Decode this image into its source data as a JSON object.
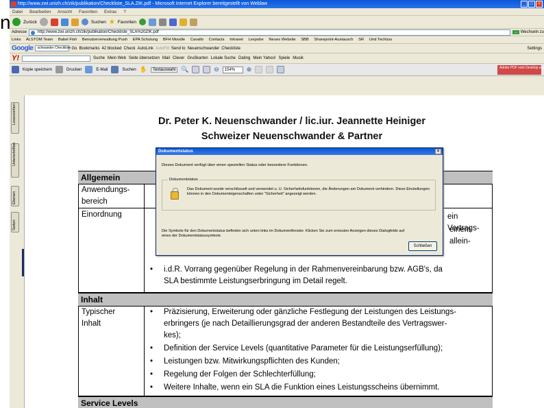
{
  "edge_char": "n",
  "browser": {
    "title": "http://www.zwi.unizh.ch/zik/publikation/Checkliste_SLA.ZIK.pdf - Microsoft Internet Explorer bereitgestellt von Weblaw",
    "menu": [
      "Datei",
      "Bearbeiten",
      "Ansicht",
      "Favoriten",
      "Extras",
      "?"
    ],
    "nav": {
      "back": "Zurück",
      "search": "Suchen",
      "favorites": "Favoriten"
    },
    "address": {
      "label": "Adresse",
      "url": "http://www.zwi.unizh.ch/zik/publikation/Checkliste_SLA%20ZIK.pdf",
      "go": "Wechseln zu"
    },
    "links": [
      "Links",
      "ALSTOM Team",
      "Babel Fish",
      "Benutzerverwaltung Push",
      "EPA Schulung",
      "BFH Moodle",
      "Cavallo",
      "Contacts",
      "Intranet",
      "Lexpobe",
      "Neues Website",
      "SBB",
      "Sharepoint-Austausch",
      "SR",
      "Und Techüss"
    ],
    "google": {
      "logo": "Google",
      "query": "schwander Checkliste",
      "go": "Go",
      "bookmarks": "Bookmarks",
      "blocked": "42 blocked",
      "check": "Check",
      "autolink": "AutoLink",
      "autofill": "AutoFill",
      "sendto": "Send to",
      "term1": "Neuenschwander",
      "term2": "Checkliste",
      "settings": "Settings"
    },
    "yahoo": {
      "logo": "Y!",
      "search": "Suche",
      "mail": "Mein Web",
      "translate": "Seite übersetzen",
      "email": "Mail",
      "clever": "Clever",
      "maps": "Grußkarten",
      "local": "Lokale Suche",
      "dating": "Dating",
      "myyahoo": "Mein Yahoo!",
      "games": "Spiele",
      "music": "Musik"
    }
  },
  "pdf_toolbar": {
    "save": "Kopie speichern",
    "print": "Drucken",
    "email": "E-Mail",
    "search": "Suchen",
    "select": "Textauswahl",
    "zoom": "154%",
    "adobe": "Adobe PDF vom Desktop aus erstellen"
  },
  "side_tabs": [
    "Lesezeichen",
    "Unterschriften",
    "Ebenen",
    "Seiten"
  ],
  "document": {
    "title_line1": "Dr. Peter K. Neuenschwander / lic.iur. Jeannette Heiniger",
    "title_line2": "Schweizer Neuenschwander & Partner",
    "sec_allgemein": "Allgemein",
    "lbl_anwendung1": "Anwendungs-",
    "lbl_anwendung2": "bereich",
    "lbl_einordnung": "Einordnung",
    "frag1": "ein Vertrags-",
    "frag2": "einem allein-",
    "bullet_vorrang_1": "i.d.R. Vorrang gegenüber Regelung in der Rahmenvereinbarung bzw. AGB's, da",
    "bullet_vorrang_2": "SLA bestimmte Leistungserbringung im Detail regelt.",
    "sec_inhalt": "Inhalt",
    "lbl_typ1": "Typischer",
    "lbl_typ2": "Inhalt",
    "inhalt_b1_l1": "Präzisierung, Erweiterung oder gänzliche Festlegung der Leistungen des Leistungs-",
    "inhalt_b1_l2": "erbringers (je nach Detaillierungsgrad der anderen Bestandteile des Vertragswer-",
    "inhalt_b1_l3": "kes);",
    "inhalt_b2": "Definition der Service Levels (quantitative Parameter für die Leistungserfüllung);",
    "inhalt_b3": "Leistungen bzw. Mitwirkungspflichten des Kunden;",
    "inhalt_b4": "Regelung der Folgen der Schlechterfüllung;",
    "inhalt_b5": "Weitere Inhalte, wenn ein SLA die Funktion eines Leistungsscheins übernimmt.",
    "sec_service": "Service Levels"
  },
  "dialog": {
    "title": "Dokumentstatus",
    "intro": "Dieses Dokument verfügt über einen speziellen Status oder besondere Funktionen.",
    "group_label": "Dokumentstatus",
    "group_text": "Das Dokument wurde verschlüsselt und verwendet  u. U. Sicherheitsfunktionen, die Änderungen am Dokument verhindern. Diese Einstellungen können in den Dokumenteigenschaften unter \"Sicherheit\" angezeigt werden.",
    "footer": "Die Symbole für den Dokumentstatus befinden sich unten links im Dokumentfenster. Klicken Sie zum erneuten Anzeigen dieses Dialogfelds auf eines der Dokumentstatussymbole.",
    "close": "Schließen"
  }
}
